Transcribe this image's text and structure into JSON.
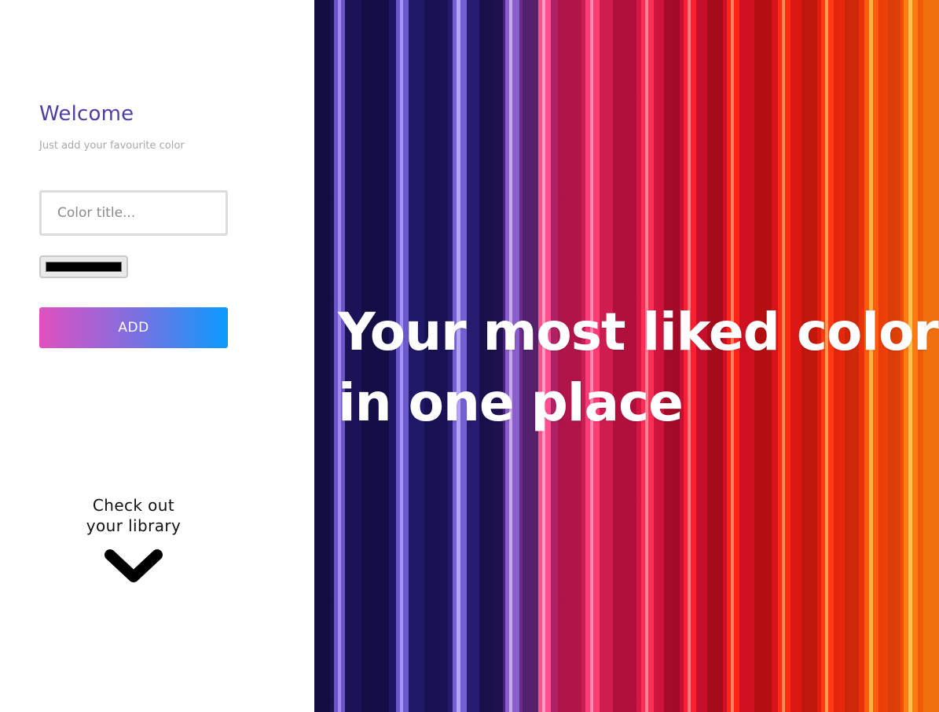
{
  "welcome": {
    "title": "Welcome",
    "subtitle": "Just add your favourite color"
  },
  "form": {
    "color_title_placeholder": "Color title...",
    "color_title_value": "",
    "color_value": "#000000",
    "add_label": "ADD"
  },
  "library": {
    "line1": "Check out",
    "line2": "your library",
    "icon": "chevron-down-icon"
  },
  "hero": {
    "line1": "Your most liked colors",
    "line2": "in one place"
  },
  "colors": {
    "title": "#4c3fa3",
    "subtitle": "#a8a8a8",
    "button_gradient_start": "#e050c0",
    "button_gradient_end": "#0a9bff"
  }
}
